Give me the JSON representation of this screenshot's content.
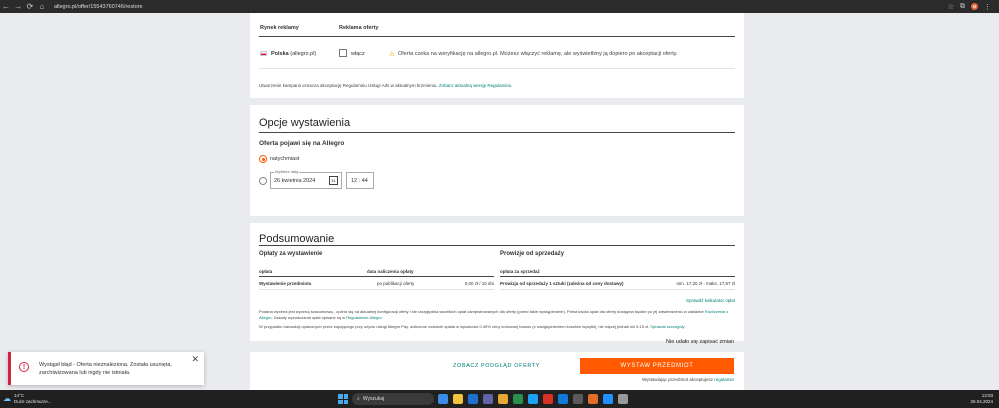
{
  "browser": {
    "url": "allegro.pl/offer/15543760746/restore",
    "back_icon": "←",
    "forward_icon": "→",
    "reload_icon": "⟳",
    "home_icon": "⌂",
    "avatar_initial": "M"
  },
  "ads": {
    "col_market": "Rynek reklamy",
    "col_ad": "Reklama oferty",
    "market_name": "Polska",
    "market_site": "(allegro.pl)",
    "enable_label": "włącz",
    "warning_text": "Oferta czeka na weryfikację na allegro.pl. Możesz włączyć reklamę, ale wyświetlimy ją dopiero po akceptacji oferty.",
    "note_text": "Utworzenie kampanii oznacza akceptację Regulaminu Usługi Ads w aktualnym brzmieniu.",
    "note_link": "Zobacz aktualną wersję Regulaminu."
  },
  "listing_options": {
    "title": "Opcje wystawienia",
    "subtitle": "Oferta pojawi się na Allegro",
    "option_now": "natychmiast",
    "date_legend": "Wybierz datę",
    "date_value": "26 kwietnia 2024",
    "calendar_icon": "31",
    "time_value": "12 : 44",
    "selected": "now"
  },
  "summary": {
    "title": "Podsumowanie",
    "fees_title": "Opłaty za wystawienie",
    "fees_headers": [
      "opłata",
      "data naliczenia opłaty"
    ],
    "fees_row": [
      "Wystawienie przedmiotu",
      "po publikacji oferty",
      "0,00 zł / 10 dni"
    ],
    "commission_title": "Prowizje od sprzedaży",
    "commission_header": "opłata za sprzedaż",
    "commission_row": [
      "Prowizja od sprzedaży 1 sztuki (zależna od ceny dostawy)",
      "min. 17,20 zł - maks. 17,67 zł"
    ],
    "calc_link": "Sprawdź kalkulator opłat",
    "info_1": "Podana wycena jest wyceną szacunkową - opiera się na aktualnej konfiguracji oferty i nie uwzględnia wszelkich opłat zarejestrowanych dla oferty (przed takie wystąpieniem). Pełna kwota opłat dla oferty dostępna będzie po jej zatwierdzeniu w zakładce",
    "info_1_link": "Rozliczenia z Allegro",
    "info_1_end": ". Zasady wyznaczania opłat opisane są w",
    "info_1_link2": "Regulaminie Allegro",
    "info_2": "W przypadku transakcji opłaconych przez kupującego przy użyciu usługi Allegro Pay, doliczone zostanie opłata w wysokości 0,40% ceny końcowej towaru (z uwzględnieniem kosztów wysyłki), nie więcej jednak niż 6,15 zł.",
    "info_2_link": "Sprawdź szczegóły"
  },
  "save_message": "Nie udało się zapisać zmian",
  "actions": {
    "preview_label": "ZOBACZ PODGLĄD OFERTY",
    "submit_label": "WYSTAW PRZEDMIOT",
    "accept_text": "Wystawiając przedmiot akceptujesz",
    "accept_link": "regulamin"
  },
  "toast": {
    "message": "Wystąpił błąd - Oferta nieznaleziona. Została usunięta, zarchiwizowana lub nigdy nie istniała.",
    "icon": "!",
    "close": "✕"
  },
  "taskbar": {
    "temperature": "14°C",
    "weather_desc": "Duże zachmurze...",
    "search_placeholder": "Wyszukaj",
    "time": "13:03",
    "date": "26.04.2024",
    "apps": [
      "#3b8ee8",
      "#f5c33b",
      "#1f6fd1",
      "#6264a7",
      "#e8a634",
      "#2a8f4a",
      "#1da1f2",
      "#d93025",
      "#0f7ad8",
      "#5a5a5a",
      "#e56d2a",
      "#1e90ff",
      "#999999"
    ]
  },
  "colors": {
    "accent": "#ff5a00",
    "link": "#00807a",
    "error": "#d4213d"
  }
}
